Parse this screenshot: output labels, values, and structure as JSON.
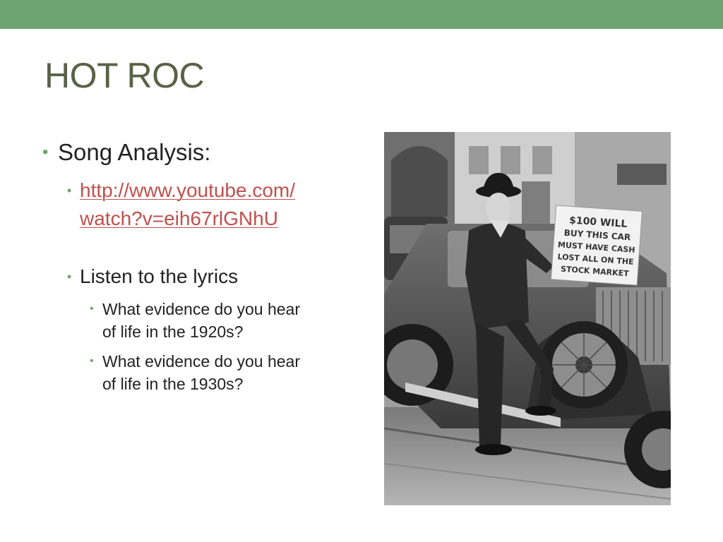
{
  "slide": {
    "title": "HOT ROC",
    "bullets": {
      "song_analysis": "Song Analysis:",
      "link_line1": "http://www.youtube.com/",
      "link_line2": "watch?v=eih67rlGNhU",
      "listen": "Listen to the lyrics",
      "q1_line1": "What evidence do you hear",
      "q1_line2": "of life in the 1920s?",
      "q2_line1": "What evidence do you hear",
      "q2_line2": "of life in the 1930s?"
    },
    "photo_sign": {
      "line1": "$100 WILL",
      "line2": "BUY THIS CAR",
      "line3": "MUST HAVE CASH",
      "line4": "LOST ALL ON THE",
      "line5": "STOCK MARKET"
    }
  },
  "colors": {
    "accent": "#6fa372",
    "title": "#5b6147",
    "link": "#c0504d",
    "text": "#222222"
  }
}
